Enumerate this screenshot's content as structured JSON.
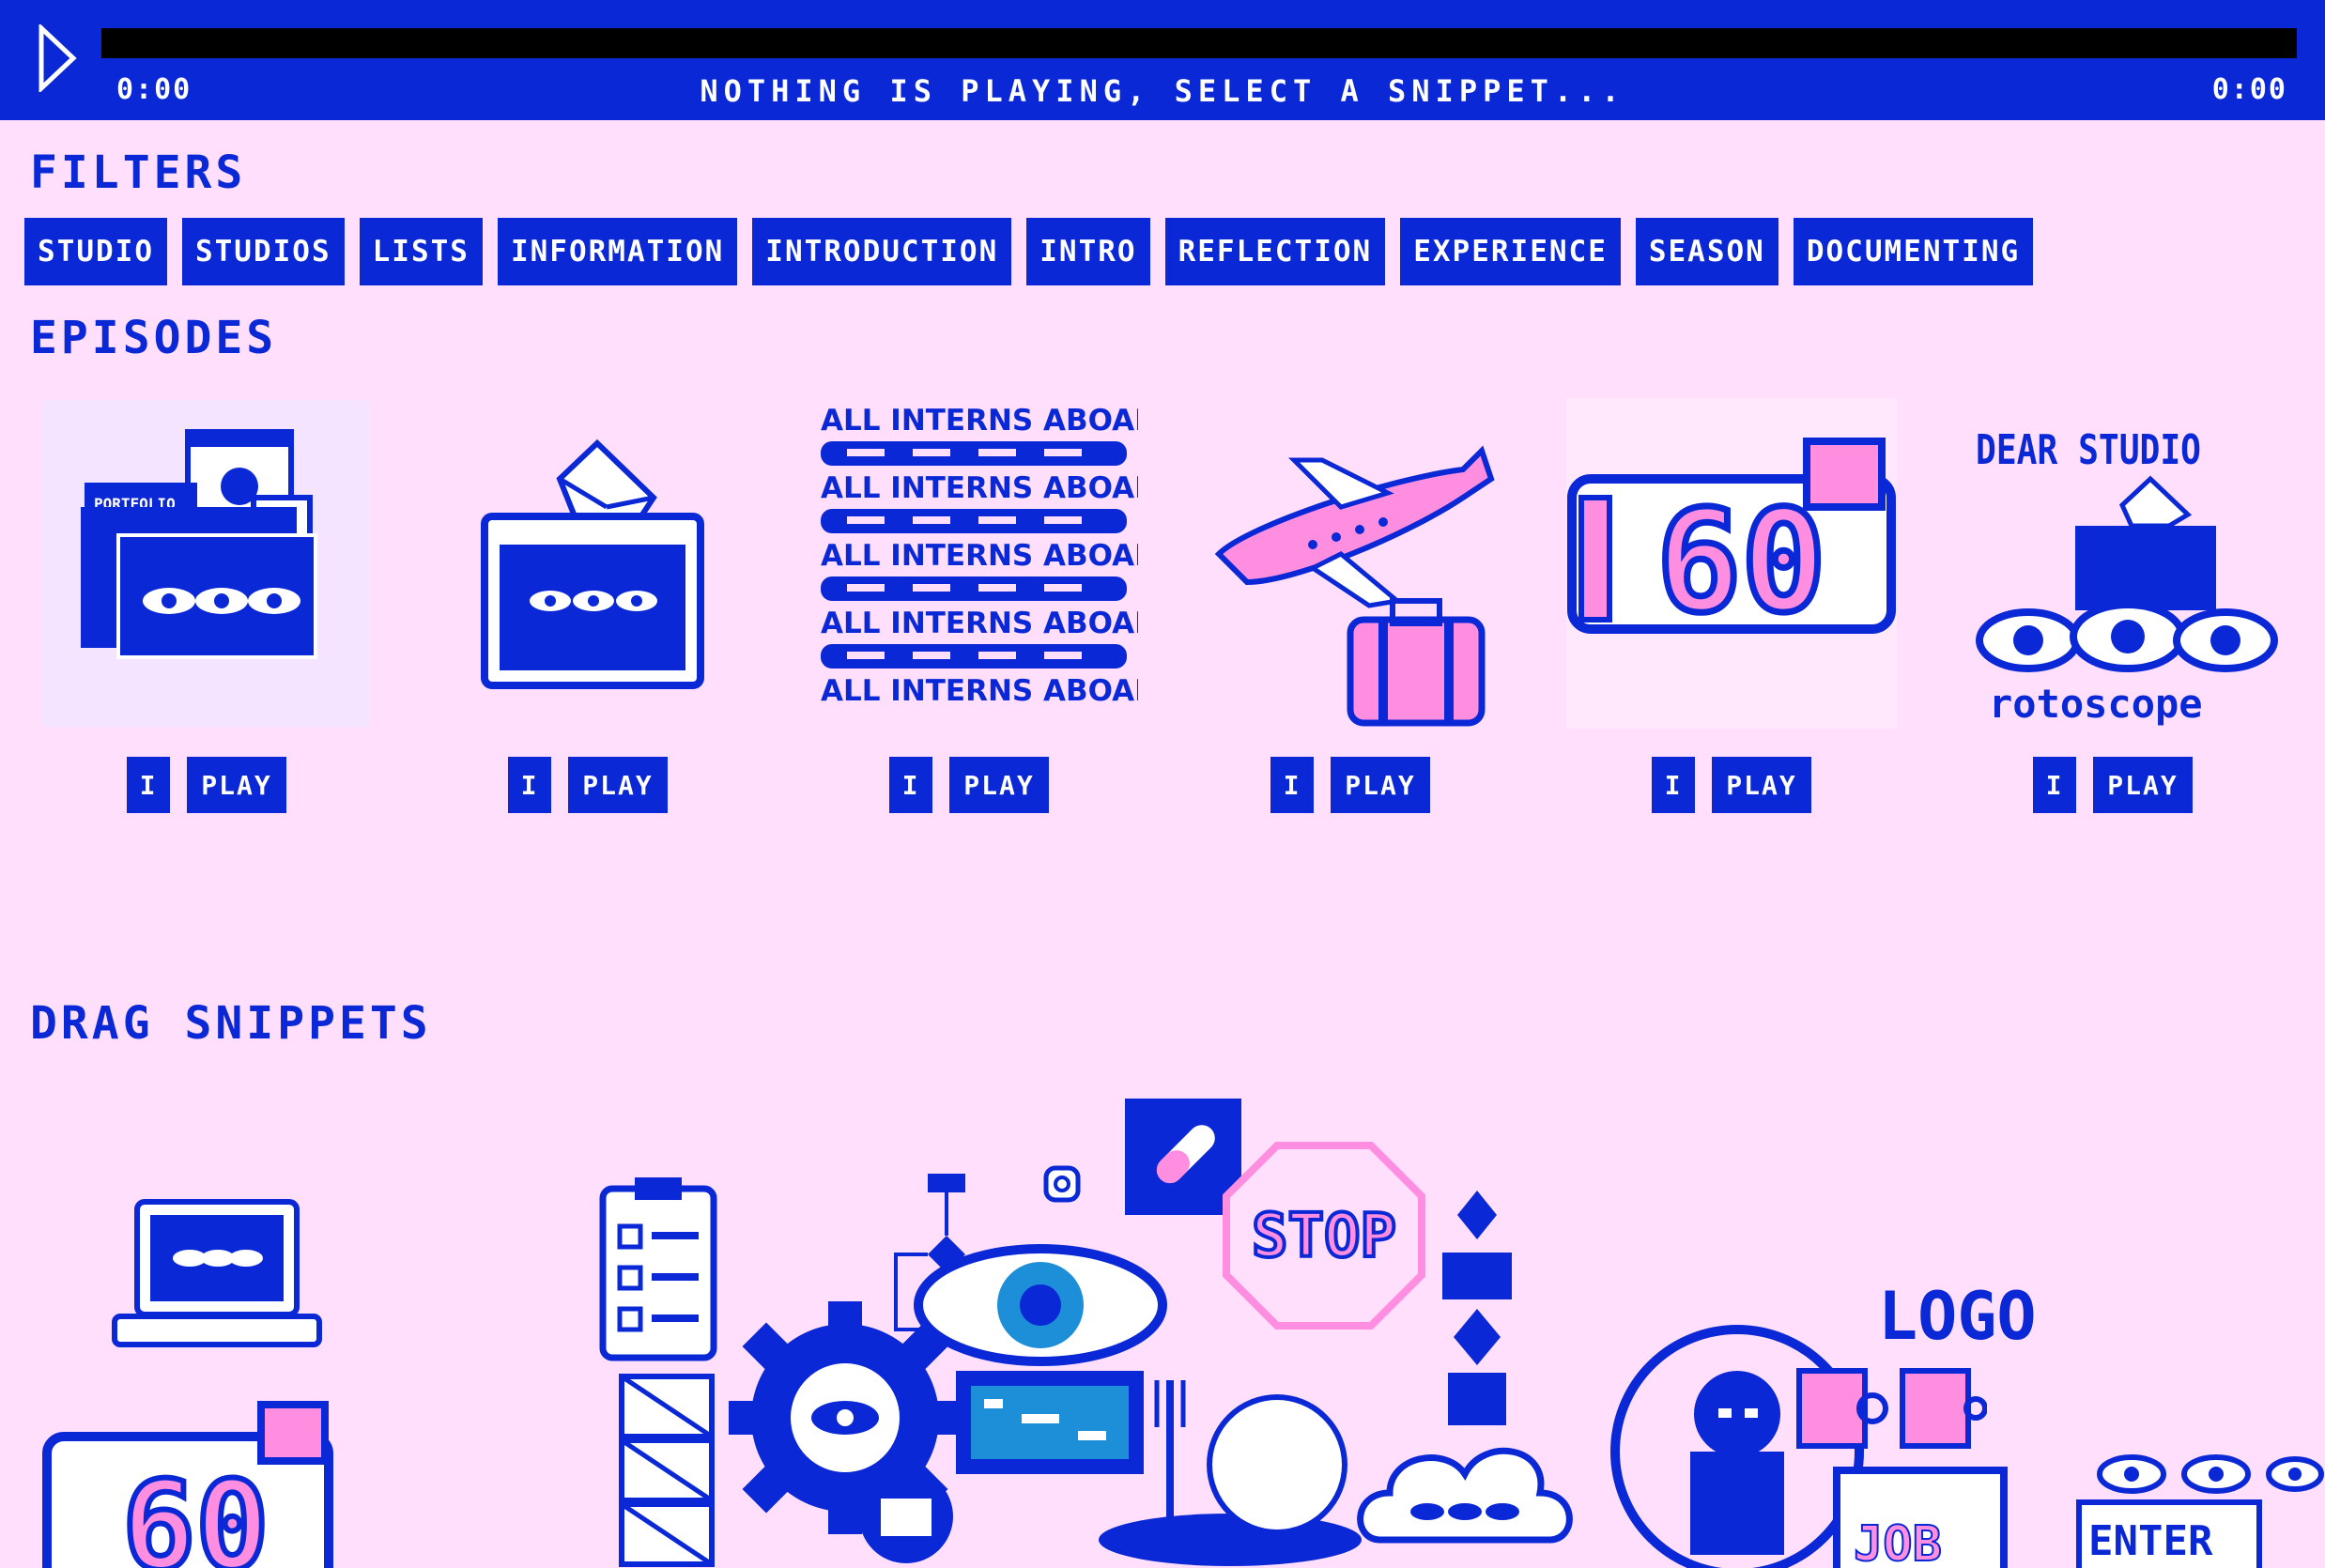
{
  "player": {
    "time_elapsed": "0:00",
    "status": "NOTHING IS PLAYING, SELECT A SNIPPET...",
    "time_total": "0:00"
  },
  "filters": {
    "heading": "FILTERS",
    "tags": [
      "STUDIO",
      "STUDIOS",
      "LISTS",
      "INFORMATION",
      "INTRODUCTION",
      "INTRO",
      "REFLECTION",
      "EXPERIENCE",
      "SEASON",
      "DOCUMENTING"
    ]
  },
  "episodes": {
    "heading": "EPISODES",
    "items": [
      {
        "cover_text": "PORTFOLIO",
        "info_label": "I",
        "play_label": "PLAY"
      },
      {
        "cover_text": "",
        "info_label": "I",
        "play_label": "PLAY"
      },
      {
        "cover_text": "ALL INTERNS ABOARD",
        "info_label": "I",
        "play_label": "PLAY"
      },
      {
        "cover_text": "",
        "info_label": "I",
        "play_label": "PLAY"
      },
      {
        "cover_text": "60",
        "info_label": "I",
        "play_label": "PLAY"
      },
      {
        "cover_text": "DEAR STUDIO",
        "cover_subtext": "rotoscope",
        "info_label": "I",
        "play_label": "PLAY"
      }
    ]
  },
  "snippets": {
    "heading": "DRAG SNIPPETS",
    "labels": {
      "stop": "STOP",
      "logo": "LOGO",
      "job": "JOB",
      "enter": "ENTER",
      "sixty": "60"
    }
  },
  "colors": {
    "blue": "#0a28d6",
    "pink": "#ffdffb",
    "accent_pink": "#ff8ee0",
    "black": "#000000",
    "white": "#ffffff"
  }
}
